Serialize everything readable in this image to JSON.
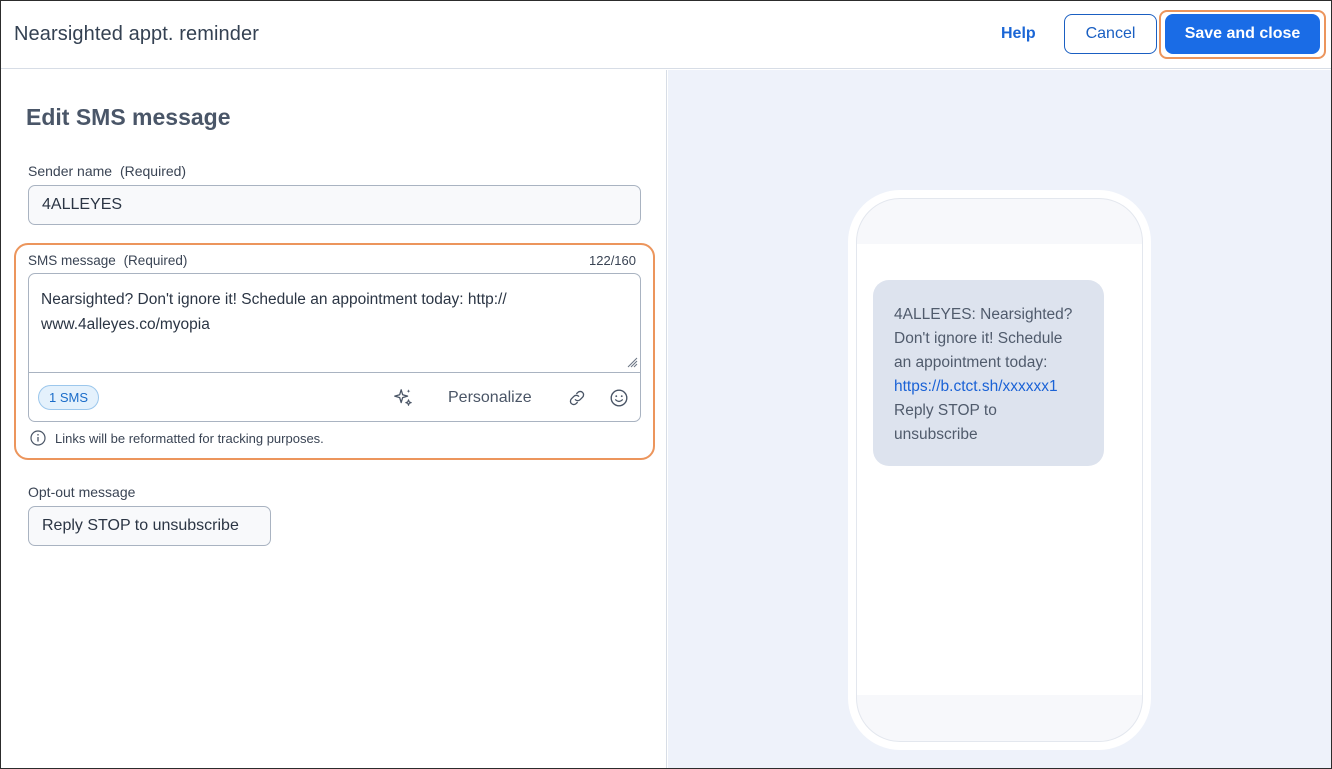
{
  "header": {
    "title": "Nearsighted appt. reminder",
    "help_label": "Help",
    "cancel_label": "Cancel",
    "save_label": "Save and close"
  },
  "editor": {
    "section_title": "Edit SMS message",
    "sender": {
      "label": "Sender name",
      "required": "(Required)",
      "value": "4ALLEYES"
    },
    "sms": {
      "label": "SMS message",
      "required": "(Required)",
      "counter": "122/160",
      "lines": [
        "Nearsighted? Don't ignore it! Schedule an appointment today: http://",
        "www.4alleyes.co/myopia"
      ],
      "badge": "1 SMS",
      "personalize_label": "Personalize",
      "info_text": "Links will be reformatted for tracking purposes."
    },
    "optout": {
      "label": "Opt-out message",
      "value": "Reply STOP to unsubscribe"
    }
  },
  "preview": {
    "bubble_lines": [
      "4ALLEYES: Nearsighted?",
      "Don't ignore it! Schedule",
      "an appointment today:"
    ],
    "bubble_link": "https://b.ctct.sh/xxxxxx1",
    "bubble_tail": [
      "Reply STOP to",
      "unsubscribe"
    ]
  },
  "colors": {
    "accent": "#1a6ce6",
    "highlight": "#ec955c",
    "preview_background": "#eef2fa",
    "bubble": "#dde3ee"
  },
  "icons": [
    "sparkle-icon",
    "link-icon",
    "emoji-icon",
    "info-icon",
    "resize-handle-icon"
  ]
}
